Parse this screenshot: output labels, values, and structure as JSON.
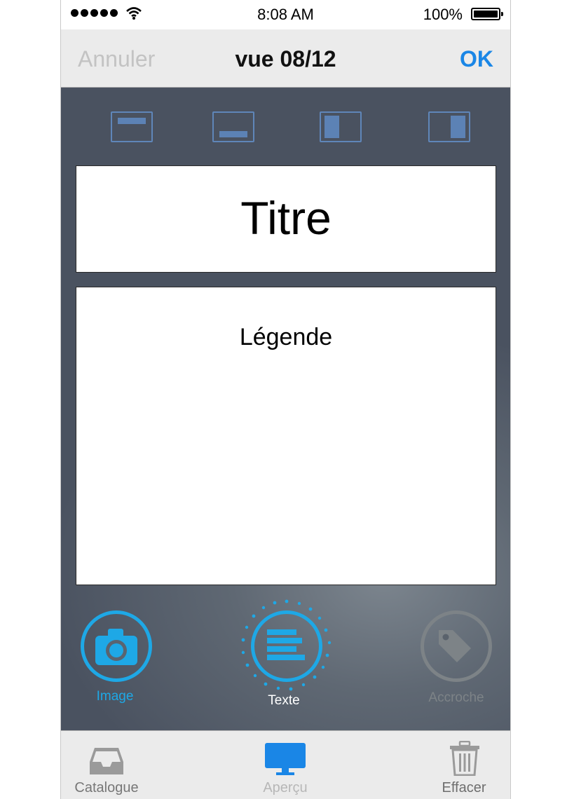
{
  "status_bar": {
    "time": "8:08 AM",
    "battery_percent": "100%",
    "signal_bars": 5,
    "wifi": "wifi-icon"
  },
  "nav": {
    "cancel_label": "Annuler",
    "title": "vue 08/12",
    "ok_label": "OK"
  },
  "layout_options": [
    {
      "icon": "layout-top-banner-icon"
    },
    {
      "icon": "layout-bottom-banner-icon"
    },
    {
      "icon": "layout-left-column-icon"
    },
    {
      "icon": "layout-right-column-icon"
    }
  ],
  "content": {
    "title_placeholder": "Titre",
    "legend_placeholder": "Légende"
  },
  "actions": {
    "image": {
      "label": "Image",
      "icon": "camera-icon"
    },
    "text": {
      "label": "Texte",
      "icon": "text-lines-icon",
      "selected": true
    },
    "hook": {
      "label": "Accroche",
      "icon": "tag-icon"
    }
  },
  "tabs": {
    "catalogue": {
      "label": "Catalogue",
      "icon": "inbox-tray-icon"
    },
    "preview": {
      "label": "Aperçu",
      "icon": "monitor-icon",
      "selected": true
    },
    "delete": {
      "label": "Effacer",
      "icon": "trash-icon"
    }
  },
  "colors": {
    "accent": "#1a86e6",
    "action_active": "#1ea8e6",
    "action_disabled": "#7d8387",
    "layout_icon": "#5c82b5",
    "panel_bg": "#4a5260"
  }
}
